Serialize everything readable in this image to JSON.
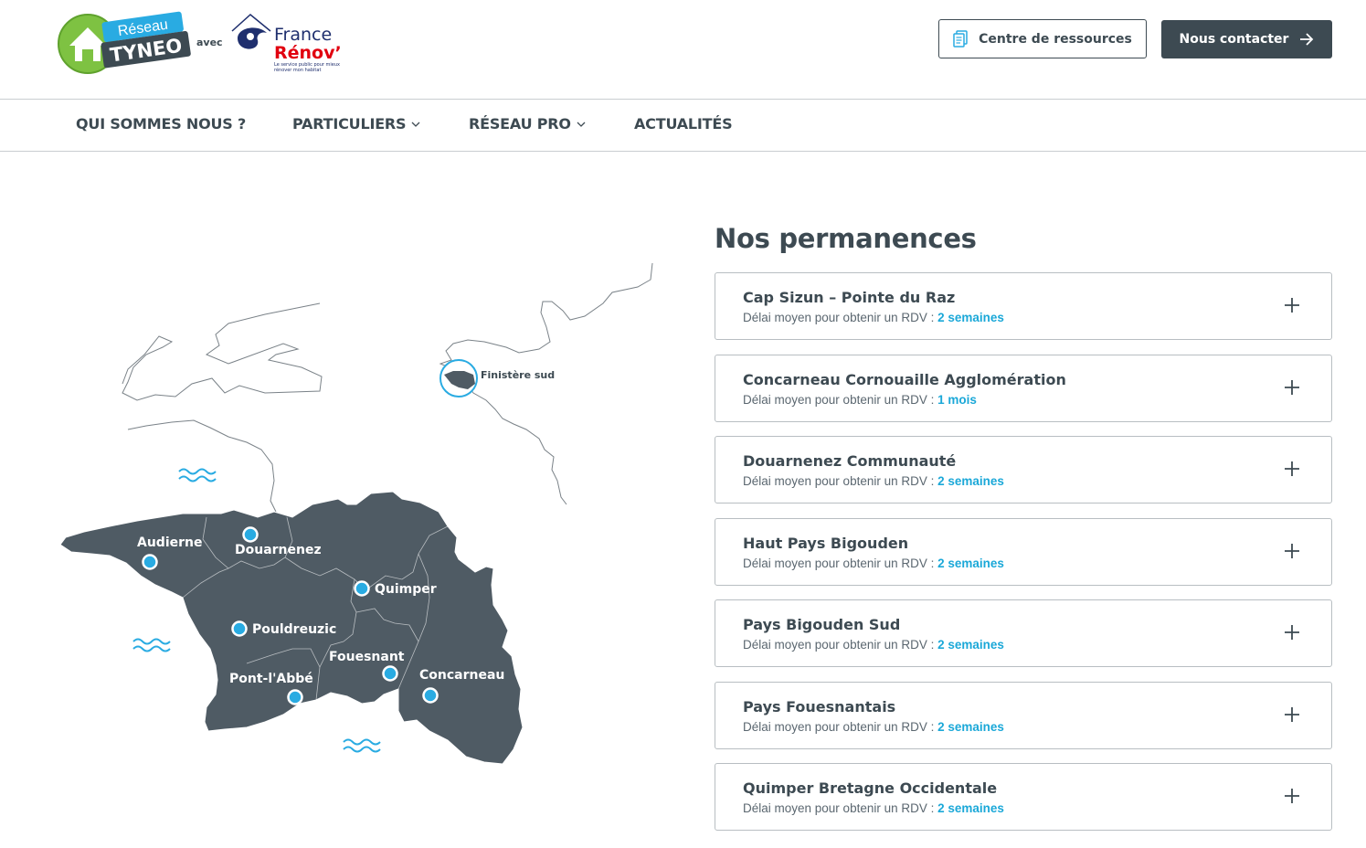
{
  "header": {
    "logo_tyneo_top": "Réseau",
    "logo_tyneo_main": "TYNEO",
    "logo_avec": "avec",
    "logo_fr_line1": "France",
    "logo_fr_line2": "Rénov’",
    "logo_fr_tagline1": "Le service public pour mieux",
    "logo_fr_tagline2": "rénover mon habitat",
    "resources_label": "Centre de ressources",
    "contact_label": "Nous contacter"
  },
  "nav": {
    "items": [
      {
        "label": "QUI SOMMES NOUS ?"
      },
      {
        "label": "PARTICULIERS"
      },
      {
        "label": "RÉSEAU PRO"
      },
      {
        "label": "ACTUALITÉS"
      }
    ]
  },
  "map": {
    "region_label": "Finistère sud",
    "cities": [
      "Audierne",
      "Douarnenez",
      "Quimper",
      "Pouldreuzic",
      "Fouesnant",
      "Pont-l'Abbé",
      "Concarneau"
    ]
  },
  "offices": {
    "title": "Nos permanences",
    "delay_prefix": "Délai moyen pour obtenir un RDV : ",
    "items": [
      {
        "name": "Cap Sizun – Pointe du Raz",
        "delay": "2 semaines"
      },
      {
        "name": "Concarneau Cornouaille Agglomération",
        "delay": "1 mois"
      },
      {
        "name": "Douarnenez Communauté",
        "delay": "2 semaines"
      },
      {
        "name": "Haut Pays Bigouden",
        "delay": "2 semaines"
      },
      {
        "name": "Pays Bigouden Sud",
        "delay": "2 semaines"
      },
      {
        "name": "Pays Fouesnantais",
        "delay": "2 semaines"
      },
      {
        "name": "Quimper Bretagne Occidentale",
        "delay": "2 semaines"
      }
    ]
  },
  "colors": {
    "primary_dark": "#3d4a52",
    "accent_blue": "#1ba8d8",
    "tyneo_green": "#7ec242",
    "fr_navy": "#1f2f6e",
    "fr_red": "#e1000f"
  }
}
